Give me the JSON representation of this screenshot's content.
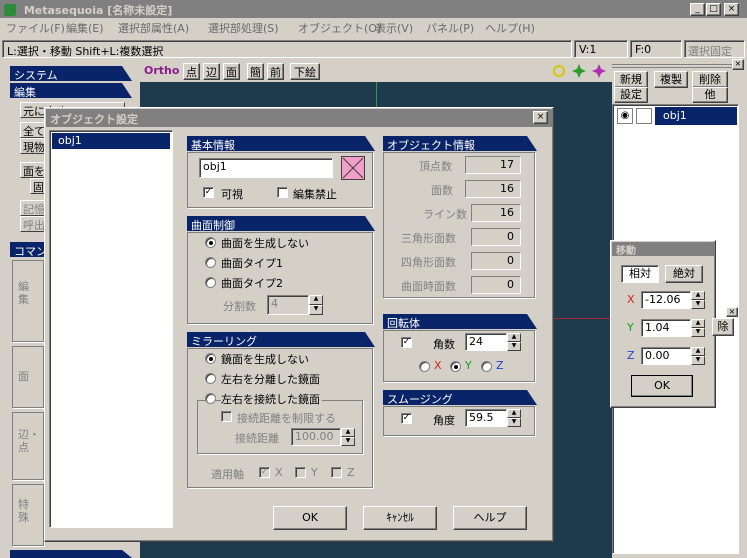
{
  "app": {
    "title": "Metasequoia [名称未設定]",
    "menus": [
      "ファイル(F)",
      "編集(E)",
      "選択部属性(A)",
      "選択部処理(S)",
      "オブジェクト(O)",
      "表示(V)",
      "パネル(P)",
      "ヘルプ(H)"
    ],
    "status": {
      "hint": "L:選択・移動  Shift+L:複数選択",
      "vertex": "V:1",
      "face": "F:0",
      "select_fixed": "選択固定"
    },
    "window_buttons": {
      "minimize": "_",
      "maximize": "□",
      "close": "×"
    }
  },
  "left_panel": {
    "system_header": "システム",
    "edit_header": "編集",
    "edit_buttons": [
      "元に戻す",
      "全て",
      "現物",
      "面を",
      "固",
      "記憶",
      "呼出"
    ],
    "command_header": "コマンド",
    "command_side_labels": [
      "編集",
      "面",
      "辺・点",
      "特殊"
    ],
    "bottom_label": "編集オプション"
  },
  "viewport": {
    "toolbar": [
      "Ortho",
      "点",
      "辺",
      "面",
      "簡",
      "前",
      "下絵"
    ],
    "bg_color": "#1f3a4d",
    "hidden_button": "除"
  },
  "object_panel": {
    "buttons": [
      "新規",
      "複製",
      "削除",
      "設定",
      "他"
    ],
    "objects": [
      {
        "name": "obj1"
      }
    ]
  },
  "move_panel": {
    "title": "移動",
    "tab_relative": "相対",
    "tab_absolute": "絶対",
    "x_label": "X",
    "y_label": "Y",
    "z_label": "Z",
    "x_value": "-12.06",
    "y_value": "1.04",
    "z_value": "0.00",
    "ok": "OK"
  },
  "dialog": {
    "title": "オブジェクト設定",
    "close": "×",
    "object_list": [
      "obj1"
    ],
    "basic": {
      "header": "基本情報",
      "name": "obj1",
      "visible_label": "可視",
      "visible_checked": true,
      "lock_label": "編集禁止",
      "lock_checked": false
    },
    "curve": {
      "header": "曲面制御",
      "options": [
        "曲面を生成しない",
        "曲面タイプ1",
        "曲面タイプ2"
      ],
      "selected": 0,
      "segments_label": "分割数",
      "segments_value": "4"
    },
    "mirror": {
      "header": "ミラーリング",
      "options": [
        "鏡面を生成しない",
        "左右を分離した鏡面",
        "左右を接続した鏡面"
      ],
      "selected": 0,
      "limit_label": "接続距離を制限する",
      "distance_label": "接続距離",
      "distance_value": "100.00",
      "axis_label": "適用軸",
      "axis_x": "X",
      "axis_y": "Y",
      "axis_z": "Z"
    },
    "info": {
      "header": "オブジェクト情報",
      "rows": [
        {
          "label": "頂点数",
          "value": "17"
        },
        {
          "label": "面数",
          "value": "16"
        },
        {
          "label": "ライン数",
          "value": "16"
        },
        {
          "label": "三角形面数",
          "value": "0"
        },
        {
          "label": "四角形面数",
          "value": "0"
        },
        {
          "label": "曲面時面数",
          "value": "0"
        }
      ]
    },
    "rotation": {
      "header": "回転体",
      "angle_label": "角数",
      "angle_value": "24",
      "checked": true,
      "axis_x": "X",
      "axis_y": "Y",
      "axis_z": "Z",
      "selected_axis": "Y"
    },
    "smoothing": {
      "header": "スムージング",
      "angle_label": "角度",
      "angle_value": "59.5",
      "checked": true
    },
    "buttons": {
      "ok": "OK",
      "cancel": "ｷｬﾝｾﾙ",
      "help": "ヘルプ"
    }
  }
}
